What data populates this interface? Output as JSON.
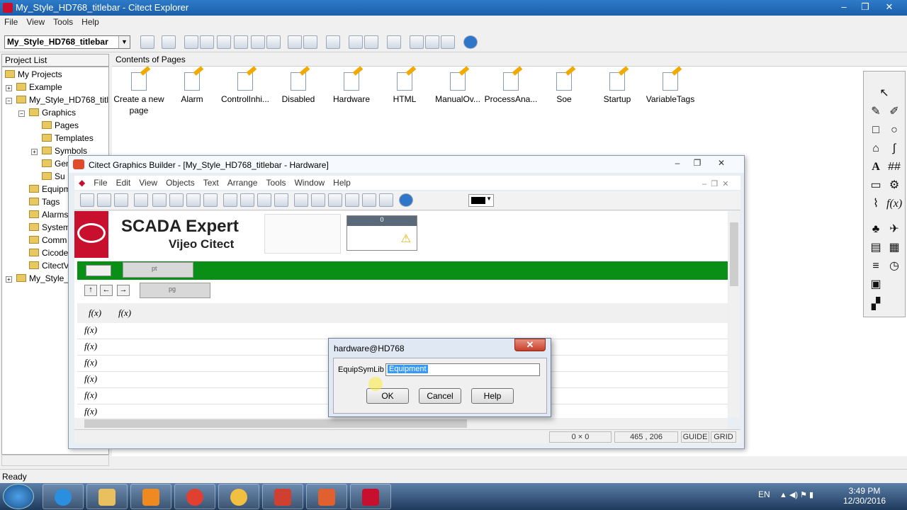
{
  "explorer": {
    "title": "My_Style_HD768_titlebar - Citect Explorer",
    "menu": [
      "File",
      "View",
      "Tools",
      "Help"
    ],
    "project_combo": "My_Style_HD768_titlebar",
    "project_list_header": "Project List",
    "contents_header": "Contents of Pages",
    "tree": {
      "my_projects": "My Projects",
      "example": "Example",
      "my_style": "My_Style_HD768_titlebar",
      "graphics": "Graphics",
      "pages": "Pages",
      "templates": "Templates",
      "symbols": "Symbols",
      "genies": "Gen",
      "super": "Su",
      "equipment": "Equipm",
      "tags": "Tags",
      "alarms": "Alarms",
      "system": "System",
      "comm": "Comm",
      "cicode": "Cicode",
      "citect": "CitectV",
      "my_style2": "My_Style_"
    },
    "pages": [
      "Create a new page",
      "Alarm",
      "ControlInhi...",
      "Disabled",
      "Hardware",
      "HTML",
      "ManualOv...",
      "ProcessAna...",
      "Soe",
      "Startup",
      "VariableTags"
    ],
    "status": "Ready"
  },
  "builder": {
    "title": "Citect Graphics Builder - [My_Style_HD768_titlebar - Hardware]",
    "menu": [
      "File",
      "Edit",
      "View",
      "Objects",
      "Text",
      "Arrange",
      "Tools",
      "Window",
      "Help"
    ],
    "scada_line1": "SCADA Expert",
    "scada_line2": "Vijeo Citect",
    "pt_label": "pt",
    "pg_label": "pg",
    "alarm_count": "0",
    "fx": "f(x)",
    "status_size": "0 × 0",
    "status_pos": "465 , 206",
    "status_guide": "GUIDE",
    "status_grid": "GRID"
  },
  "dialog": {
    "title": "hardware@HD768",
    "label": "EquipSymLib",
    "value": "Equipment",
    "ok": "OK",
    "cancel": "Cancel",
    "help": "Help"
  },
  "taskbar": {
    "lang": "EN",
    "time": "3:49 PM",
    "date": "12/30/2016"
  },
  "colors": {
    "title_blue": "#1b5fa8",
    "scada_red": "#c8102e",
    "bar_green": "#0a8f16"
  }
}
